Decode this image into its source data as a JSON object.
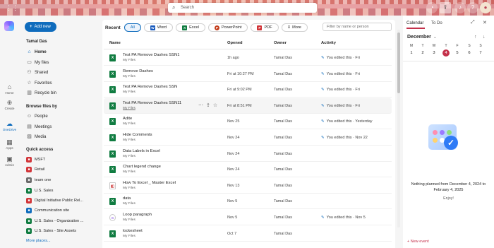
{
  "topbar": {
    "search_placeholder": "Search",
    "icons": [
      "app-launcher-icon",
      "copilot-icon",
      "bell-icon",
      "help-icon",
      "avatar"
    ]
  },
  "rail": {
    "items": [
      {
        "label": "Home",
        "icon": "home-icon"
      },
      {
        "label": "Create",
        "icon": "create-icon"
      },
      {
        "label": "OneDrive",
        "icon": "onedrive-icon"
      },
      {
        "label": "Apps",
        "icon": "apps-icon"
      },
      {
        "label": "Admin",
        "icon": "admin-icon"
      }
    ]
  },
  "sidebar": {
    "add_new": "Add new",
    "user": "Tamal Das",
    "items": [
      {
        "label": "Home",
        "icon": "home-icon"
      },
      {
        "label": "My files",
        "icon": "folder-icon"
      },
      {
        "label": "Shared",
        "icon": "people-icon"
      },
      {
        "label": "Favorites",
        "icon": "star-icon"
      },
      {
        "label": "Recycle bin",
        "icon": "trash-icon"
      }
    ],
    "browse_title": "Browse files by",
    "browse_items": [
      {
        "label": "People",
        "icon": "person-icon"
      },
      {
        "label": "Meetings",
        "icon": "calendar-icon"
      },
      {
        "label": "Media",
        "icon": "image-icon"
      }
    ],
    "quick_title": "Quick access",
    "quick_items": [
      {
        "label": "MSFT",
        "color": "#d13438"
      },
      {
        "label": "Retail",
        "color": "#d13438"
      },
      {
        "label": "team one",
        "color": "#6b6b6b"
      },
      {
        "label": "U.S. Sales",
        "color": "#107c41"
      },
      {
        "label": "Digital Initiative Public Rel...",
        "color": "#d13438"
      },
      {
        "label": "Communication site",
        "color": "#0f6cbd"
      },
      {
        "label": "U.S. Sales - Organization ...",
        "color": "#107c41"
      },
      {
        "label": "U.S. Sales - Site Assets",
        "color": "#107c41"
      }
    ],
    "more_places": "More places..."
  },
  "main": {
    "recent_label": "Recent",
    "chips": [
      {
        "label": "All",
        "icon": "",
        "color": "#0f6cbd"
      },
      {
        "label": "Word",
        "icon": "W",
        "color": "#185abd"
      },
      {
        "label": "Excel",
        "icon": "X",
        "color": "#107c41"
      },
      {
        "label": "PowerPoint",
        "icon": "P",
        "color": "#c43e1c"
      },
      {
        "label": "PDF",
        "icon": "P",
        "color": "#d13438"
      },
      {
        "label": "More",
        "icon": "",
        "color": "#424242"
      }
    ],
    "filter_placeholder": "Filter by name or person",
    "columns": {
      "name": "Name",
      "opened": "Opened",
      "owner": "Owner",
      "activity": "Activity"
    },
    "rows": [
      {
        "name": "Test PA Remove Dashes SSN1",
        "location": "My Files",
        "opened": "1h ago",
        "owner": "Tamal Das",
        "activity": "You edited this · Fri",
        "type": "excel"
      },
      {
        "name": "Remove Dashes",
        "location": "My Files",
        "opened": "Fri at 10:27 PM",
        "owner": "Tamal Das",
        "activity": "You edited this · Fri",
        "type": "excel"
      },
      {
        "name": "Test PA Remove Dashes SSN",
        "location": "My Files",
        "opened": "Fri at 9:02 PM",
        "owner": "Tamal Das",
        "activity": "You edited this · Fri",
        "type": "excel"
      },
      {
        "name": "Test PA Remove Dashes SSN11",
        "location": "My Files",
        "opened": "Fri at 8:51 PM",
        "owner": "Tamal Das",
        "activity": "You edited this · Fri",
        "type": "excel"
      },
      {
        "name": "Adite",
        "location": "My Files",
        "opened": "Nov 25",
        "owner": "Tamal Das",
        "activity": "You edited this · Yesterday",
        "type": "excel"
      },
      {
        "name": "Hide Comments",
        "location": "My Files",
        "opened": "Nov 24",
        "owner": "Tamal Das",
        "activity": "You edited this · Nov 22",
        "type": "excel"
      },
      {
        "name": "Data Labels in Excel",
        "location": "My Files",
        "opened": "Nov 24",
        "owner": "Tamal Das",
        "activity": "",
        "type": "excel"
      },
      {
        "name": "Chart legend change",
        "location": "My Files",
        "opened": "Nov 24",
        "owner": "Tamal Das",
        "activity": "",
        "type": "excel"
      },
      {
        "name": "How To Excel _ Master Excel",
        "location": "My Files",
        "opened": "Nov 13",
        "owner": "Tamal Das",
        "activity": "",
        "type": "html"
      },
      {
        "name": "data",
        "location": "My Files",
        "opened": "Nov 5",
        "owner": "Tamal Das",
        "activity": "",
        "type": "excel"
      },
      {
        "name": "Loop paragraph",
        "location": "My Files",
        "opened": "Nov 5",
        "owner": "Tamal Das",
        "activity": "You edited this · Nov 5",
        "type": "loop"
      },
      {
        "name": "lockesheet",
        "location": "My Files",
        "opened": "Oct 7",
        "owner": "Tamal Das",
        "activity": "",
        "type": "excel"
      }
    ]
  },
  "calendar": {
    "tabs": [
      "Calendar",
      "To Do"
    ],
    "month": "December",
    "weekdays": [
      "M",
      "T",
      "W",
      "T",
      "F",
      "S",
      "S"
    ],
    "days": [
      "2",
      "3",
      "4",
      "5",
      "6",
      "7"
    ],
    "first_day": "1",
    "today": "4",
    "empty_message": "Nothing planned from December 4, 2024 to February 4, 2025",
    "enjoy": "Enjoy!",
    "new_event": "New event",
    "accent": "#c4314b"
  }
}
